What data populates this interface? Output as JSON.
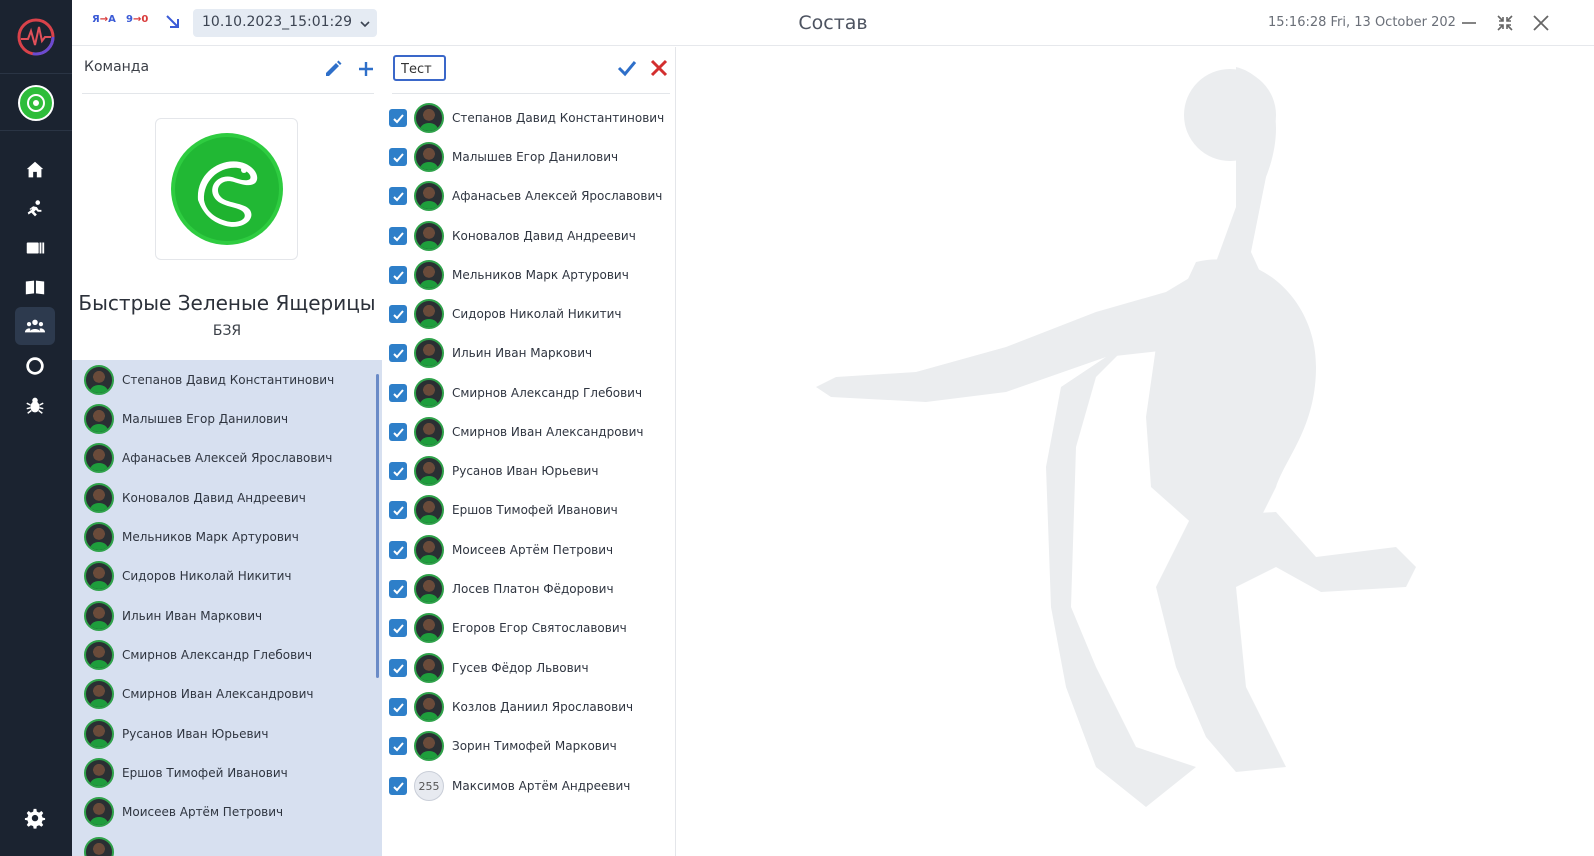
{
  "topbar": {
    "lang_from": "Я",
    "lang_to": "A",
    "score_left": "9",
    "score_right": "0",
    "date_value": "10.10.2023_15:01:29",
    "page_title": "Состав",
    "clock": "15:16:28  Fri, 13 October 202"
  },
  "team": {
    "header": "Команда",
    "name": "Быстрые Зеленые Ящерицы",
    "abbr": "БЗЯ",
    "players": [
      "Степанов Давид Константинович",
      "Малышев Егор Данилович",
      "Афанасьев Алексей Ярославович",
      "Коновалов Давид Андреевич",
      "Мельников Марк Артурович",
      "Сидоров Николай Никитич",
      "Ильин Иван Маркович",
      "Смирнов Александр Глебович",
      "Смирнов Иван Александрович",
      "Русанов Иван Юрьевич",
      "Ершов Тимофей  Иванович",
      "Моисеев Артём Петрович"
    ]
  },
  "editor": {
    "input_value": "Тест",
    "players": [
      "Степанов Давид Константинович",
      "Малышев Егор Данилович",
      "Афанасьев Алексей Ярославович",
      "Коновалов Давид Андреевич",
      "Мельников Марк Артурович",
      "Сидоров Николай Никитич",
      "Ильин Иван Маркович",
      "Смирнов Александр Глебович",
      "Смирнов Иван Александрович",
      "Русанов Иван Юрьевич",
      "Ершов Тимофей  Иванович",
      "Моисеев Артём Петрович",
      "Лосев Платон  Фёдорович",
      "Егоров Егор Святославович",
      "Гусев Фёдор Львович",
      "Козлов Даниил Ярославович",
      "Зорин Тимофей Маркович",
      "Максимов Артём Андреевич"
    ],
    "last_avatar_number": "255"
  },
  "colors": {
    "sidebar_bg": "#1b2330",
    "accent_blue": "#2e7fc9",
    "roster_bg": "#d7e0f0",
    "team_green": "#2ebd3a",
    "cancel_red": "#d32f2f"
  }
}
